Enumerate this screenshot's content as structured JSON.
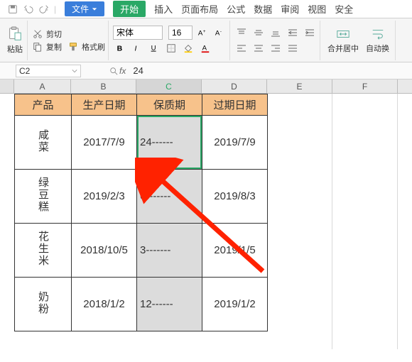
{
  "menubar": {
    "file": "文件",
    "tabs": [
      "开始",
      "插入",
      "页面布局",
      "公式",
      "数据",
      "审阅",
      "视图",
      "安全"
    ],
    "active_index": 0
  },
  "ribbon": {
    "paste": "粘贴",
    "cut": "剪切",
    "copy": "复制",
    "format_painter": "格式刷",
    "font_name": "宋体",
    "font_size": "16",
    "merge_center": "合并居中",
    "auto_wrap": "自动换"
  },
  "namebox": "C2",
  "formula": "24",
  "columns": [
    "A",
    "B",
    "C",
    "D",
    "E",
    "F"
  ],
  "headers": {
    "A": "产品",
    "B": "生产日期",
    "C": "保质期",
    "D": "过期日期"
  },
  "rows": [
    {
      "A": "咸菜",
      "B": "2017/7/9",
      "C": "24------",
      "D": "2019/7/9"
    },
    {
      "A": "绿豆糕",
      "B": "2019/2/3",
      "C": "6-------",
      "D": "2019/8/3"
    },
    {
      "A": "花生米",
      "B": "2018/10/5",
      "C": "3-------",
      "D": "2019/1/5"
    },
    {
      "A": "奶粉",
      "B": "2018/1/2",
      "C": "12------",
      "D": "2019/1/2"
    }
  ],
  "selected_column": "C"
}
